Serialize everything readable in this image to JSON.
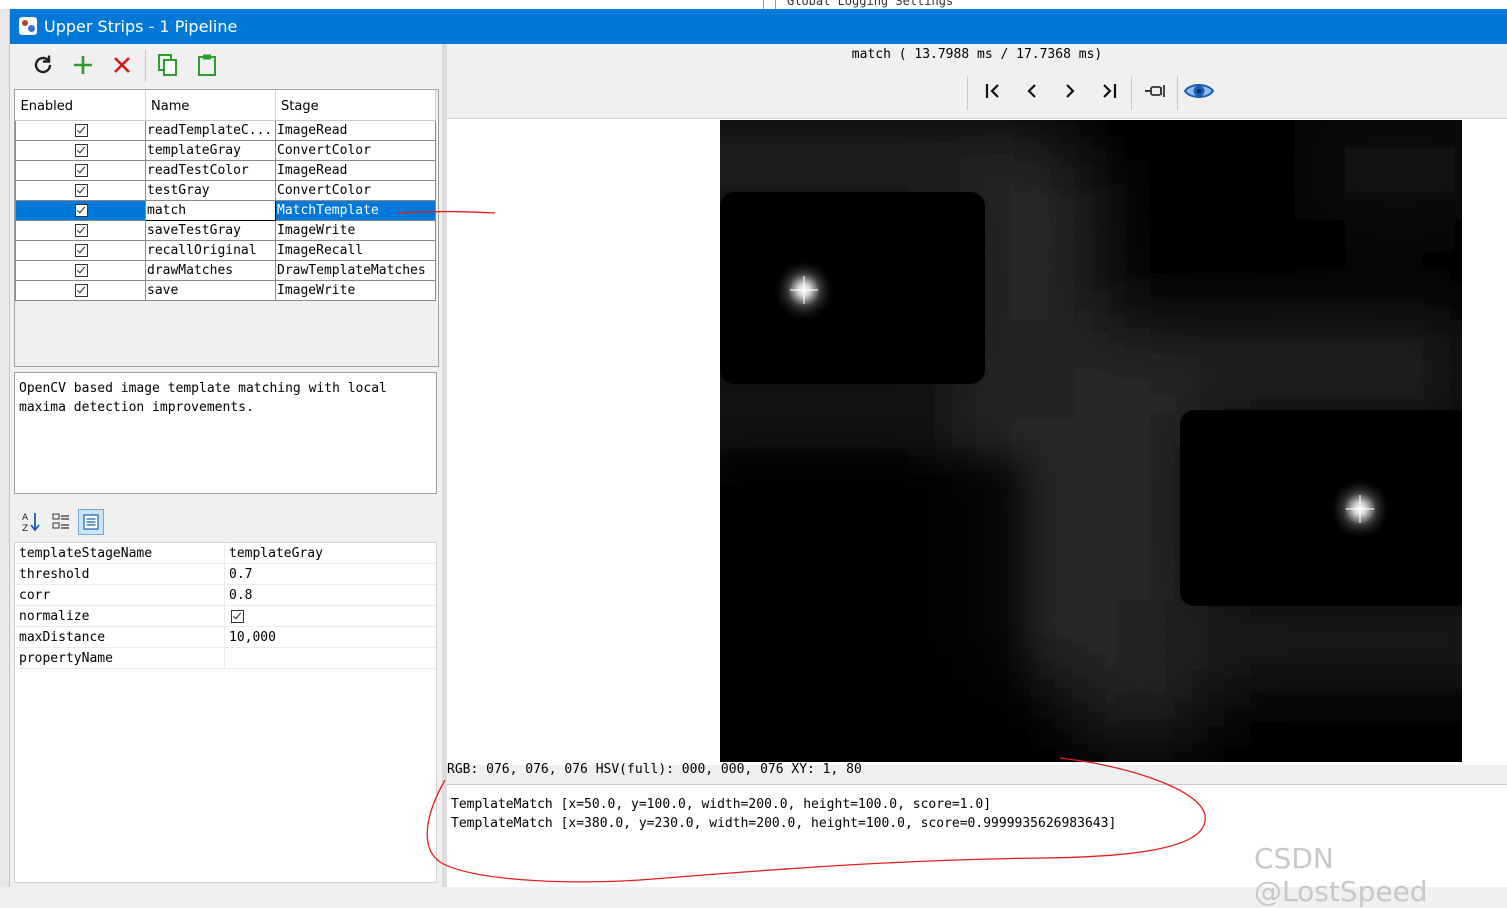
{
  "background": {
    "behind_window_text": "Global Logging Settings"
  },
  "window": {
    "title": "Upper Strips - 1 Pipeline",
    "icon": "app-icon"
  },
  "toolbar": {
    "refresh_icon": "refresh-icon",
    "add_icon": "plus-icon",
    "delete_icon": "x-icon",
    "copy_icon": "copy-icon",
    "paste_icon": "clipboard-icon",
    "colors": {
      "refresh": "#222222",
      "add": "#2e9c2e",
      "delete": "#d11a1a",
      "copy_paste": "#2e9c2e"
    }
  },
  "pipeline": {
    "columns": [
      "Enabled",
      "Name",
      "Stage"
    ],
    "rows": [
      {
        "enabled": true,
        "name": "readTemplateC...",
        "stage": "ImageRead"
      },
      {
        "enabled": true,
        "name": "templateGray",
        "stage": "ConvertColor"
      },
      {
        "enabled": true,
        "name": "readTestColor",
        "stage": "ImageRead"
      },
      {
        "enabled": true,
        "name": "testGray",
        "stage": "ConvertColor"
      },
      {
        "enabled": true,
        "name": "match",
        "stage": "MatchTemplate",
        "selected": true
      },
      {
        "enabled": true,
        "name": "saveTestGray",
        "stage": "ImageWrite"
      },
      {
        "enabled": true,
        "name": "recallOriginal",
        "stage": "ImageRecall"
      },
      {
        "enabled": true,
        "name": "drawMatches",
        "stage": "DrawTemplateMatches"
      },
      {
        "enabled": true,
        "name": "save",
        "stage": "ImageWrite"
      }
    ],
    "selection_color": "#0078d7"
  },
  "description": "OpenCV based image template matching with local maxima detection improvements.",
  "properties_toolbar": {
    "sort_icon": "sort-az-icon",
    "categorized_icon": "categorized-icon",
    "list_icon": "list-view-icon"
  },
  "properties": [
    {
      "key": "templateStageName",
      "value": "templateGray"
    },
    {
      "key": "threshold",
      "value": "0.7"
    },
    {
      "key": "corr",
      "value": "0.8"
    },
    {
      "key": "normalize",
      "value": "",
      "checkbox": true
    },
    {
      "key": "maxDistance",
      "value": "10,000"
    },
    {
      "key": "propertyName",
      "value": ""
    }
  ],
  "viewer": {
    "timing": "match ( 13.7988 ms / 17.7368 ms)",
    "nav": {
      "first_icon": "first-frame-icon",
      "prev_icon": "chevron-left-icon",
      "next_icon": "chevron-right-icon",
      "last_icon": "last-frame-icon",
      "pin_icon": "pin-icon",
      "eye_icon": "eye-icon"
    },
    "pixel_info": "RGB: 076, 076, 076 HSV(full): 000, 000, 076 XY: 1, 80",
    "results": [
      "TemplateMatch [x=50.0, y=100.0, width=200.0, height=100.0, score=1.0]",
      "TemplateMatch [x=380.0, y=230.0, width=200.0, height=100.0, score=0.9999935626983643]"
    ]
  },
  "watermark": "CSDN @LostSpeed",
  "annotation_color": "#e02020"
}
